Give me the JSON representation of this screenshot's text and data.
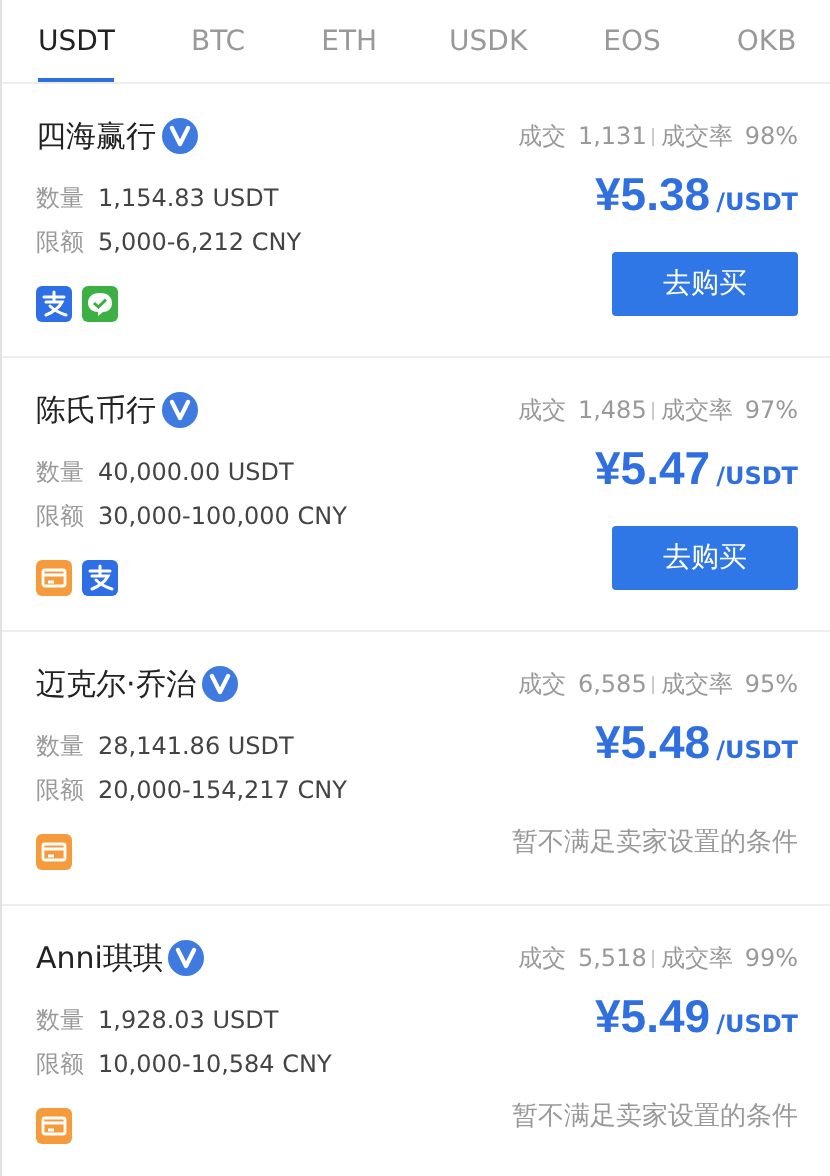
{
  "tabs": [
    {
      "label": "USDT",
      "selected": true
    },
    {
      "label": "BTC",
      "selected": false
    },
    {
      "label": "ETH",
      "selected": false
    },
    {
      "label": "USDK",
      "selected": false
    },
    {
      "label": "EOS",
      "selected": false
    },
    {
      "label": "OKB",
      "selected": false
    }
  ],
  "offers": [
    {
      "merchant": "四海赢行",
      "verified": true,
      "deals_label": "成交",
      "deals": "1,131",
      "rate_label": "成交率",
      "rate": "98%",
      "amount_label": "数量",
      "amount": "1,154.83 USDT",
      "limit_label": "限额",
      "limit": "5,000-6,212 CNY",
      "price": "¥5.38",
      "unit": "/USDT",
      "payments": [
        {
          "kind": "alipay"
        },
        {
          "kind": "wechat"
        }
      ],
      "action": {
        "kind": "button",
        "text": "去购买"
      }
    },
    {
      "merchant": "陈氏币行",
      "verified": true,
      "deals_label": "成交",
      "deals": "1,485",
      "rate_label": "成交率",
      "rate": "97%",
      "amount_label": "数量",
      "amount": "40,000.00 USDT",
      "limit_label": "限额",
      "limit": "30,000-100,000 CNY",
      "price": "¥5.47",
      "unit": "/USDT",
      "payments": [
        {
          "kind": "bank"
        },
        {
          "kind": "alipay"
        }
      ],
      "action": {
        "kind": "button",
        "text": "去购买"
      }
    },
    {
      "merchant": "迈克尔·乔治",
      "verified": true,
      "deals_label": "成交",
      "deals": "6,585",
      "rate_label": "成交率",
      "rate": "95%",
      "amount_label": "数量",
      "amount": "28,141.86 USDT",
      "limit_label": "限额",
      "limit": "20,000-154,217 CNY",
      "price": "¥5.48",
      "unit": "/USDT",
      "payments": [
        {
          "kind": "bank"
        }
      ],
      "action": {
        "kind": "note",
        "text": "暂不满足卖家设置的条件"
      }
    },
    {
      "merchant": "Anni琪琪",
      "verified": true,
      "deals_label": "成交",
      "deals": "5,518",
      "rate_label": "成交率",
      "rate": "99%",
      "amount_label": "数量",
      "amount": "1,928.03 USDT",
      "limit_label": "限额",
      "limit": "10,000-10,584 CNY",
      "price": "¥5.49",
      "unit": "/USDT",
      "payments": [
        {
          "kind": "bank"
        }
      ],
      "action": {
        "kind": "note",
        "text": "暂不满足卖家设置的条件"
      }
    }
  ]
}
